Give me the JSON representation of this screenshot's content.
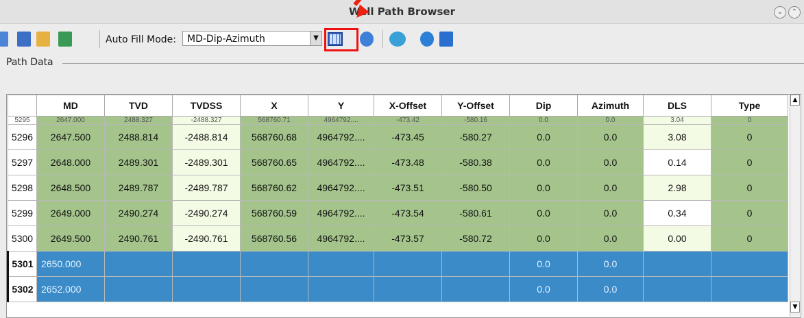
{
  "window": {
    "title": "Well Path Browser"
  },
  "toolbar": {
    "auto_fill_label": "Auto Fill Mode:",
    "auto_fill_value": "MD-Dip-Azimuth",
    "dropdown_arrow": "▼"
  },
  "section": {
    "label": "Path Data"
  },
  "table": {
    "headers": [
      "MD",
      "TVD",
      "TVDSS",
      "X",
      "Y",
      "X-Offset",
      "Y-Offset",
      "Dip",
      "Azimuth",
      "DLS",
      "Type"
    ],
    "partial_row": {
      "row": "5295",
      "cells": [
        "2647.000",
        "2488.327",
        "-2488.327",
        "568760.71",
        "4964792....",
        "-473.42",
        "-580.16",
        "0.0",
        "0.0",
        "3.04",
        "0"
      ]
    },
    "rows": [
      {
        "row": "5296",
        "cells": [
          "2647.500",
          "2488.814",
          "-2488.814",
          "568760.68",
          "4964792....",
          "-473.45",
          "-580.27",
          "0.0",
          "0.0",
          "3.08",
          "0"
        ]
      },
      {
        "row": "5297",
        "cells": [
          "2648.000",
          "2489.301",
          "-2489.301",
          "568760.65",
          "4964792....",
          "-473.48",
          "-580.38",
          "0.0",
          "0.0",
          "0.14",
          "0"
        ]
      },
      {
        "row": "5298",
        "cells": [
          "2648.500",
          "2489.787",
          "-2489.787",
          "568760.62",
          "4964792....",
          "-473.51",
          "-580.50",
          "0.0",
          "0.0",
          "2.98",
          "0"
        ]
      },
      {
        "row": "5299",
        "cells": [
          "2649.000",
          "2490.274",
          "-2490.274",
          "568760.59",
          "4964792....",
          "-473.54",
          "-580.61",
          "0.0",
          "0.0",
          "0.34",
          "0"
        ]
      },
      {
        "row": "5300",
        "cells": [
          "2649.500",
          "2490.761",
          "-2490.761",
          "568760.56",
          "4964792....",
          "-473.57",
          "-580.72",
          "0.0",
          "0.0",
          "0.00",
          "0"
        ]
      },
      {
        "row": "5301",
        "cells": [
          "2650.000",
          "",
          "",
          "",
          "",
          "",
          "",
          "0.0",
          "0.0",
          "",
          ""
        ]
      },
      {
        "row": "5302",
        "cells": [
          "2652.000",
          "",
          "",
          "",
          "",
          "",
          "",
          "0.0",
          "0.0",
          "",
          ""
        ]
      }
    ]
  },
  "colors": {
    "computed": "#a4c48c",
    "editable": "#f3fbe5",
    "selected": "#3a8bc8",
    "highlight": "#e11111"
  }
}
